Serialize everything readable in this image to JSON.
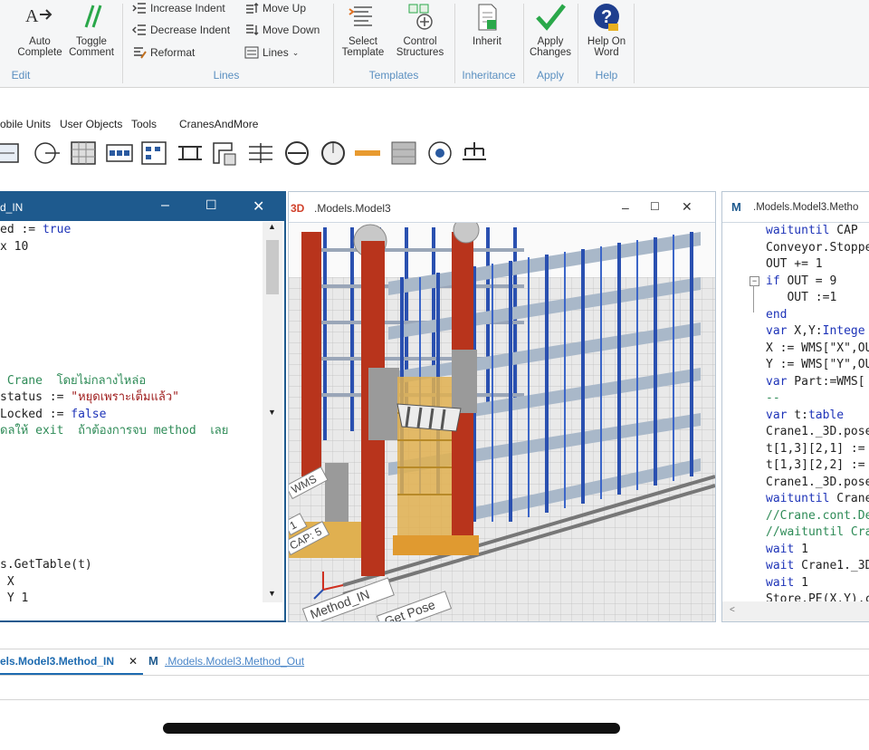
{
  "ribbon": {
    "edit_group": {
      "label": "Edit",
      "auto_complete": "Auto\nComplete",
      "toggle_comment": "Toggle\nComment"
    },
    "lines_group": {
      "label": "Lines",
      "increase_indent": "Increase Indent",
      "decrease_indent": "Decrease Indent",
      "reformat": "Reformat",
      "move_up": "Move Up",
      "move_down": "Move Down",
      "lines": "Lines"
    },
    "templates_group": {
      "label": "Templates",
      "select_template": "Select\nTemplate",
      "control_structures": "Control\nStructures"
    },
    "inheritance_group": {
      "label": "Inheritance",
      "inherit": "Inherit"
    },
    "apply_group": {
      "label": "Apply",
      "apply_changes": "Apply\nChanges"
    },
    "help_group": {
      "label": "Help",
      "help_on_word": "Help On\nWord"
    }
  },
  "menubar": {
    "items": [
      "obile Units",
      "User Objects",
      "Tools",
      "CranesAndMore"
    ]
  },
  "left_editor": {
    "title": "d_IN",
    "lines": [
      {
        "parts": [
          {
            "t": "ed := ",
            "c": "plain"
          },
          {
            "t": "true",
            "c": "kw"
          }
        ]
      },
      {
        "parts": [
          {
            "t": "x 10",
            "c": "plain"
          }
        ]
      },
      {
        "parts": []
      },
      {
        "parts": []
      },
      {
        "parts": []
      },
      {
        "parts": []
      },
      {
        "parts": []
      },
      {
        "parts": []
      },
      {
        "parts": []
      },
      {
        "parts": [
          {
            "t": " Crane  โดยไม่กลางไหล่อ",
            "c": "cmt"
          }
        ]
      },
      {
        "parts": [
          {
            "t": "status := ",
            "c": "plain"
          },
          {
            "t": "\"หยุดเพราะเต็มแล้ว\"",
            "c": "str"
          }
        ]
      },
      {
        "parts": [
          {
            "t": "Locked := ",
            "c": "plain"
          },
          {
            "t": "false",
            "c": "kw"
          }
        ]
      },
      {
        "parts": [
          {
            "t": "ดลให้ exit  ถ้าต้องการจบ method  เลย",
            "c": "cmt"
          }
        ]
      },
      {
        "parts": []
      },
      {
        "parts": []
      },
      {
        "parts": []
      },
      {
        "parts": []
      },
      {
        "parts": []
      },
      {
        "parts": []
      },
      {
        "parts": []
      },
      {
        "parts": [
          {
            "t": "s.GetTable(t)",
            "c": "plain"
          }
        ]
      },
      {
        "parts": [
          {
            "t": " X",
            "c": "plain"
          }
        ]
      },
      {
        "parts": [
          {
            "t": " Y 1",
            "c": "plain"
          }
        ]
      }
    ]
  },
  "mid_viewer": {
    "title": ".Models.Model3",
    "badge": "3D",
    "labels": [
      "WMS",
      "1",
      "CAP: 5",
      "Method_IN",
      "Get Pose"
    ]
  },
  "right_editor": {
    "title": ".Models.Model3.Metho",
    "lines": [
      {
        "parts": [
          {
            "t": "waituntil",
            "c": "kw"
          },
          {
            "t": " CAP ",
            "c": "plain"
          }
        ]
      },
      {
        "parts": [
          {
            "t": "Conveyor.Stoppe",
            "c": "plain"
          }
        ]
      },
      {
        "parts": [
          {
            "t": "OUT += 1",
            "c": "plain"
          }
        ]
      },
      {
        "parts": [
          {
            "t": "if",
            "c": "kw"
          },
          {
            "t": " OUT = 9",
            "c": "plain"
          }
        ]
      },
      {
        "parts": [
          {
            "t": "   OUT :=1",
            "c": "plain"
          }
        ]
      },
      {
        "parts": [
          {
            "t": "end",
            "c": "kw"
          }
        ]
      },
      {
        "parts": [
          {
            "t": "var",
            "c": "kw"
          },
          {
            "t": " X,Y:",
            "c": "plain"
          },
          {
            "t": "Intege",
            "c": "kw"
          }
        ]
      },
      {
        "parts": [
          {
            "t": "X := WMS[\"X\",OU",
            "c": "plain"
          }
        ]
      },
      {
        "parts": [
          {
            "t": "Y := WMS[\"Y\",OU",
            "c": "plain"
          }
        ]
      },
      {
        "parts": [
          {
            "t": "var",
            "c": "kw"
          },
          {
            "t": " Part:=WMS[",
            "c": "plain"
          }
        ]
      },
      {
        "parts": [
          {
            "t": "--",
            "c": "cmt"
          }
        ]
      },
      {
        "parts": [
          {
            "t": "var",
            "c": "kw"
          },
          {
            "t": " t:",
            "c": "plain"
          },
          {
            "t": "table",
            "c": "kw"
          }
        ]
      },
      {
        "parts": [
          {
            "t": "Crane1._3D.pose",
            "c": "plain"
          }
        ]
      },
      {
        "parts": [
          {
            "t": "t[1,3][2,1] :=",
            "c": "plain"
          }
        ]
      },
      {
        "parts": [
          {
            "t": "t[1,3][2,2] :=",
            "c": "plain"
          }
        ]
      },
      {
        "parts": [
          {
            "t": "Crane1._3D.pose",
            "c": "plain"
          }
        ]
      },
      {
        "parts": [
          {
            "t": "waituntil",
            "c": "kw"
          },
          {
            "t": " Crane",
            "c": "plain"
          }
        ]
      },
      {
        "parts": [
          {
            "t": "//Crane.cont.De",
            "c": "cmt"
          }
        ]
      },
      {
        "parts": [
          {
            "t": "//waituntil Cra",
            "c": "cmt"
          }
        ]
      },
      {
        "parts": [
          {
            "t": "wait",
            "c": "kw"
          },
          {
            "t": " 1",
            "c": "plain"
          }
        ]
      },
      {
        "parts": [
          {
            "t": "wait",
            "c": "kw"
          },
          {
            "t": " Crane1._3D",
            "c": "plain"
          }
        ]
      },
      {
        "parts": [
          {
            "t": "wait",
            "c": "kw"
          },
          {
            "t": " 1",
            "c": "plain"
          }
        ]
      },
      {
        "parts": [
          {
            "t": "Store.PE(X,Y).c",
            "c": "plain"
          }
        ]
      }
    ]
  },
  "tabs": {
    "tab1": "els.Model3.Method_IN",
    "tab2": ".Models.Model3.Method_Out"
  },
  "colors": {
    "accent": "#1e5a8e",
    "kw": "#1d33b8",
    "str": "#a02020",
    "cmt": "#2e8b57",
    "tab_active": "#1e6bb0"
  }
}
